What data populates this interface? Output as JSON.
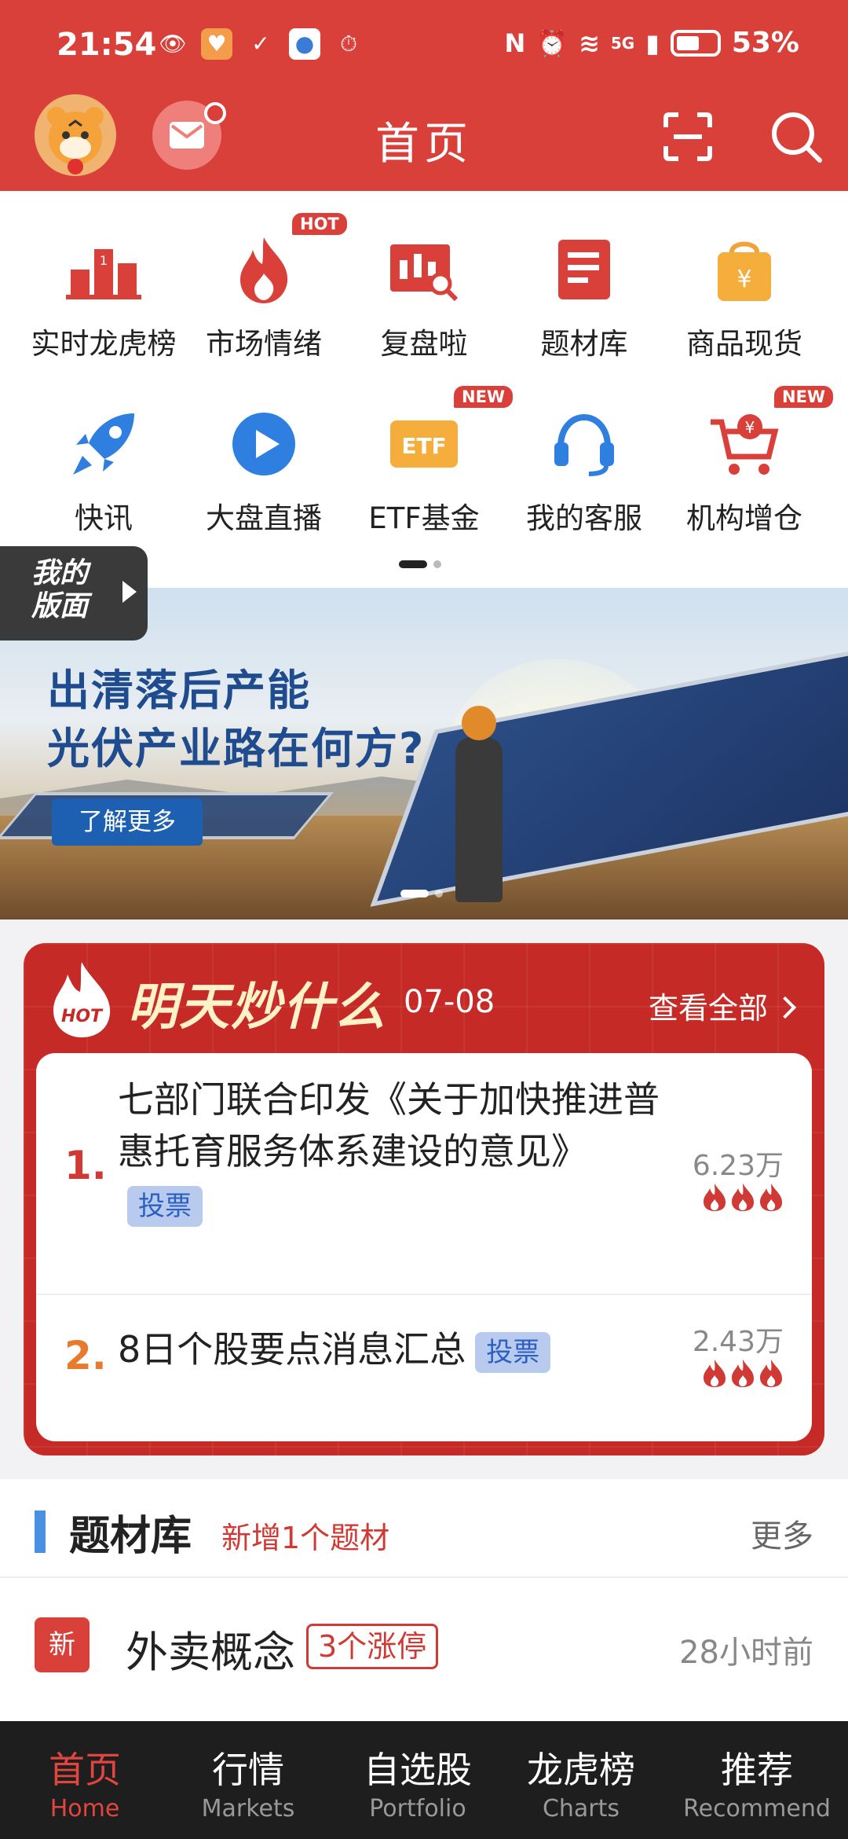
{
  "status_bar": {
    "time": "21:54",
    "network": "5G",
    "battery": "53%"
  },
  "header": {
    "title": "首页",
    "avatar_icon": "tiger-avatar",
    "mail_icon": "mail-icon",
    "scan_icon": "scan-icon",
    "search_icon": "search-icon"
  },
  "grid": {
    "items": [
      {
        "label": "实时龙虎榜",
        "icon": "podium-icon",
        "badge": ""
      },
      {
        "label": "市场情绪",
        "icon": "flame-icon",
        "badge": "HOT"
      },
      {
        "label": "复盘啦",
        "icon": "candlestick-search-icon",
        "badge": ""
      },
      {
        "label": "题材库",
        "icon": "document-icon",
        "badge": ""
      },
      {
        "label": "商品现货",
        "icon": "shopping-bag-icon",
        "badge": ""
      },
      {
        "label": "快讯",
        "icon": "rocket-icon",
        "badge": ""
      },
      {
        "label": "大盘直播",
        "icon": "play-icon",
        "badge": ""
      },
      {
        "label": "ETF基金",
        "icon": "etf-icon",
        "badge": "NEW"
      },
      {
        "label": "我的客服",
        "icon": "headset-icon",
        "badge": ""
      },
      {
        "label": "机构增仓",
        "icon": "cart-icon",
        "badge": "NEW"
      }
    ],
    "my_layout_line1": "我的",
    "my_layout_line2": "版面"
  },
  "banner": {
    "line1": "出清落后产能",
    "line2": "光伏产业路在何方?",
    "button": "了解更多"
  },
  "hot": {
    "title": "明天炒什么",
    "date": "07-08",
    "view_all": "查看全部",
    "items": [
      {
        "rank": "1.",
        "text": "七部门联合印发《关于加快推进普惠托育服务体系建设的意见》",
        "tag": "投票",
        "count": "6.23万",
        "rank_color": "#d03a35"
      },
      {
        "rank": "2.",
        "text": "8日个股要点消息汇总",
        "tag": "投票",
        "count": "2.43万",
        "rank_color": "#e87a2d"
      }
    ]
  },
  "topic": {
    "title": "题材库",
    "new_note": "新增1个题材",
    "more": "更多",
    "row": {
      "badge": "新",
      "name": "外卖概念",
      "tag": "3个涨停",
      "time": "28小时前"
    }
  },
  "bottom_nav": [
    {
      "cn": "首页",
      "en": "Home",
      "active": true
    },
    {
      "cn": "行情",
      "en": "Markets",
      "active": false
    },
    {
      "cn": "自选股",
      "en": "Portfolio",
      "active": false
    },
    {
      "cn": "龙虎榜",
      "en": "Charts",
      "active": false
    },
    {
      "cn": "推荐",
      "en": "Recommend",
      "active": false
    }
  ]
}
